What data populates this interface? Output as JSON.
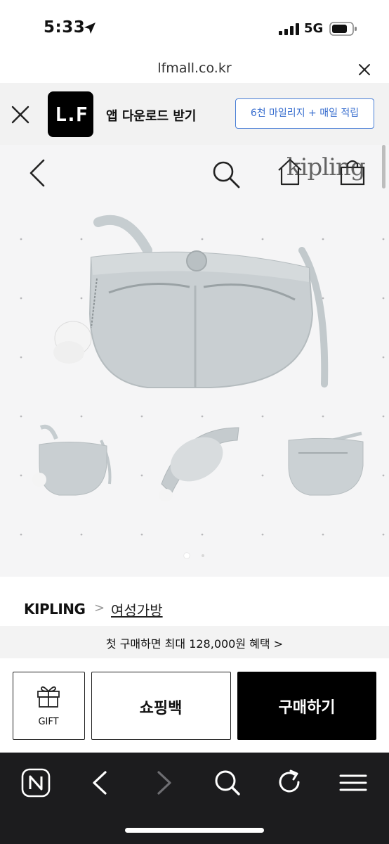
{
  "status_bar": {
    "time": "5:33",
    "network": "5G"
  },
  "url_bar": {
    "domain": "lfmall.co.kr"
  },
  "app_banner": {
    "logo_text": "L.F",
    "title": "앱 다운로드 받기",
    "cta_label": "6천 마일리지 + 매일 적립"
  },
  "hero": {
    "brand_logo": "kipling",
    "carousel_current_page": 1,
    "carousel_total_pages": 2,
    "product_color": "#c9cfd2",
    "background": "#f5f5f6"
  },
  "breadcrumb": {
    "brand": "KIPLING",
    "separator": ">",
    "category": "여성가방"
  },
  "promo": {
    "text": "첫 구매하면 최대 128,000원 혜택 >"
  },
  "actions": {
    "gift_label": "GIFT",
    "cart_label": "쇼핑백",
    "buy_label": "구매하기"
  },
  "toolbar": {
    "icons": [
      "naver-icon",
      "back-icon",
      "forward-icon",
      "search-icon",
      "refresh-icon",
      "menu-icon"
    ],
    "forward_enabled": false
  },
  "colors": {
    "accent_blue": "#3a6fcf",
    "buy_button": "#000000",
    "toolbar_bg": "#1c1c1e"
  }
}
